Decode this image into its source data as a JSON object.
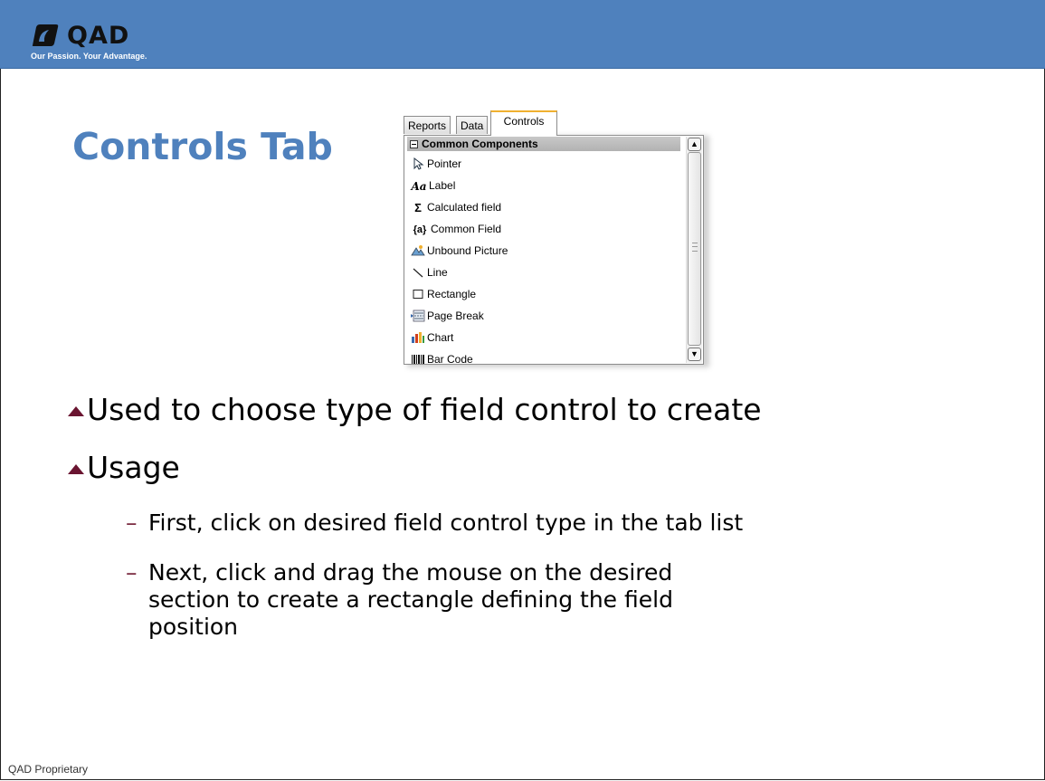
{
  "header": {
    "logo_text": "QAD",
    "tagline": "Our Passion. Your Advantage."
  },
  "slide": {
    "title": "Controls Tab"
  },
  "toolbox": {
    "tabs": [
      "Reports",
      "Data",
      "Controls"
    ],
    "active_tab": "Controls",
    "group": "Common Components",
    "items": [
      {
        "label": "Pointer",
        "icon": "pointer-icon"
      },
      {
        "label": "Label",
        "icon": "label-icon"
      },
      {
        "label": "Calculated field",
        "icon": "sigma-icon"
      },
      {
        "label": "Common Field",
        "icon": "field-braces-icon"
      },
      {
        "label": "Unbound Picture",
        "icon": "picture-icon"
      },
      {
        "label": "Line",
        "icon": "line-icon"
      },
      {
        "label": "Rectangle",
        "icon": "rectangle-icon"
      },
      {
        "label": "Page Break",
        "icon": "page-break-icon"
      },
      {
        "label": "Chart",
        "icon": "chart-icon"
      },
      {
        "label": "Bar Code",
        "icon": "barcode-icon"
      }
    ]
  },
  "bullets": [
    {
      "text": "Used to choose type of field control to create"
    },
    {
      "text": "Usage"
    }
  ],
  "sub_bullets": [
    {
      "text": "First, click on desired field control type in the tab list"
    },
    {
      "text": "Next, click and drag the mouse on the desired section to create a rectangle defining the field position"
    }
  ],
  "footer": {
    "text": "QAD Proprietary"
  },
  "colors": {
    "header": "#4f81bd",
    "title": "#4f81bd",
    "bullet_marker": "#6a1531"
  }
}
